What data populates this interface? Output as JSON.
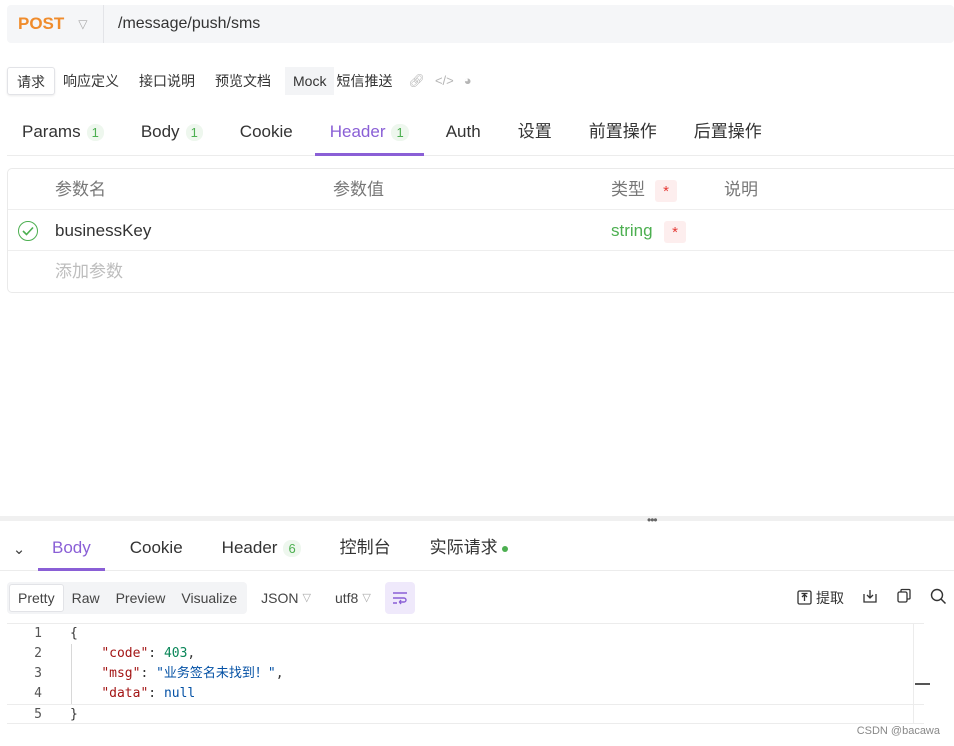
{
  "request": {
    "method": "POST",
    "url": "/message/push/sms"
  },
  "mode_tabs": {
    "active": "请求",
    "items": [
      "响应定义",
      "接口说明",
      "预览文档",
      "Mock",
      "短信推送"
    ]
  },
  "request_tabs": [
    {
      "label": "Params",
      "count": "1"
    },
    {
      "label": "Body",
      "count": "1"
    },
    {
      "label": "Cookie",
      "count": ""
    },
    {
      "label": "Header",
      "count": "1"
    },
    {
      "label": "Auth",
      "count": ""
    },
    {
      "label": "设置",
      "count": ""
    },
    {
      "label": "前置操作",
      "count": ""
    },
    {
      "label": "后置操作",
      "count": ""
    }
  ],
  "params_table": {
    "headers": {
      "name": "参数名",
      "value": "参数值",
      "type": "类型",
      "required_mark": "*",
      "desc": "说明"
    },
    "rows": [
      {
        "name": "businessKey",
        "value": "",
        "type": "string",
        "required": "*"
      }
    ],
    "add_placeholder": "添加参数"
  },
  "response_tabs": [
    {
      "label": "Body",
      "count": ""
    },
    {
      "label": "Cookie",
      "count": ""
    },
    {
      "label": "Header",
      "count": "6"
    },
    {
      "label": "控制台",
      "count": ""
    },
    {
      "label": "实际请求",
      "count": ""
    }
  ],
  "response_toolbar": {
    "formats": [
      "Pretty",
      "Raw",
      "Preview",
      "Visualize"
    ],
    "language": "JSON",
    "encoding": "utf8",
    "extract_label": "提取"
  },
  "response_code": {
    "line_numbers": [
      "1",
      "2",
      "3",
      "4",
      "5"
    ],
    "open": "{",
    "close": "}",
    "fields": [
      {
        "key": "\"code\"",
        "value": "403",
        "kind": "num",
        "trail": ","
      },
      {
        "key": "\"msg\"",
        "value": "\"业务签名未找到！\"",
        "kind": "str",
        "trail": ","
      },
      {
        "key": "\"data\"",
        "value": "null",
        "kind": "nul",
        "trail": ""
      }
    ]
  },
  "watermark": "CSDN @bacawa",
  "colors": {
    "method": "#f08c2c",
    "accent": "#8a5fd6",
    "green": "#4caf50",
    "required": "#e53935"
  }
}
